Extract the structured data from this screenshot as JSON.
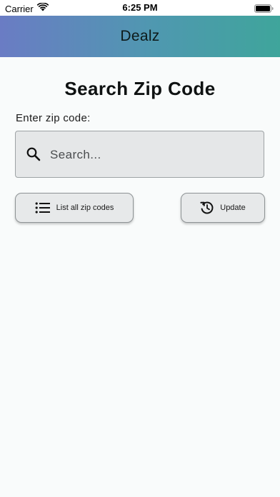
{
  "status_bar": {
    "carrier": "Carrier",
    "time": "6:25 PM",
    "icons": [
      "wifi-icon",
      "battery-icon"
    ]
  },
  "header": {
    "title": "Dealz",
    "gradient": [
      "#6a7cc4",
      "#3fa59b"
    ]
  },
  "main": {
    "title": "Search Zip Code",
    "field_label": "Enter zip code:",
    "search": {
      "placeholder": "Search...",
      "value": "",
      "icon": "search-icon"
    },
    "buttons": {
      "list_all": {
        "label": "List all zip codes",
        "icon": "list-icon"
      },
      "update": {
        "label": "Update",
        "icon": "refresh-icon"
      }
    }
  }
}
